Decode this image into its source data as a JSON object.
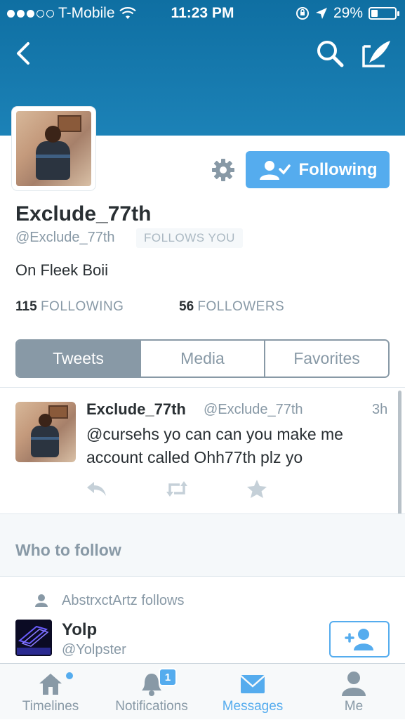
{
  "status_bar": {
    "carrier": "T-Mobile",
    "time": "11:23 PM",
    "battery": "29%",
    "battery_level": 0.29,
    "signal_bars_filled": 3,
    "signal_bars_total": 5
  },
  "nav": {
    "back_icon": "chevron-left-icon",
    "search_icon": "search-icon",
    "compose_icon": "compose-icon"
  },
  "profile": {
    "display_name": "Exclude_77th",
    "screen_name": "@Exclude_77th",
    "follows_you": "FOLLOWS YOU",
    "bio": "On Fleek Boii",
    "following_count": "115",
    "following_label": "FOLLOWING",
    "followers_count": "56",
    "followers_label": "FOLLOWERS",
    "follow_button_label": "Following"
  },
  "segmented": {
    "tabs": [
      "Tweets",
      "Media",
      "Favorites"
    ],
    "active": "Tweets"
  },
  "tweet": {
    "name": "Exclude_77th",
    "handle": "@Exclude_77th",
    "time": "3h",
    "text": "@cursehs yo can can you make me account called Ohh77th plz yo"
  },
  "who_to_follow": {
    "title": "Who to follow",
    "context": "AbstrxctArtz follows",
    "suggestion": {
      "name": "Yolp",
      "handle": "@Yolpster",
      "avatar_text": "YOLP"
    }
  },
  "tab_bar": {
    "items": [
      {
        "label": "Timelines",
        "icon": "home-icon"
      },
      {
        "label": "Notifications",
        "icon": "bell-icon",
        "badge": "1"
      },
      {
        "label": "Messages",
        "icon": "envelope-icon"
      },
      {
        "label": "Me",
        "icon": "person-icon"
      }
    ],
    "active": "Messages"
  },
  "colors": {
    "header": "#1c82b7",
    "accent": "#55acee",
    "muted": "#8899a6",
    "text": "#292f33"
  }
}
